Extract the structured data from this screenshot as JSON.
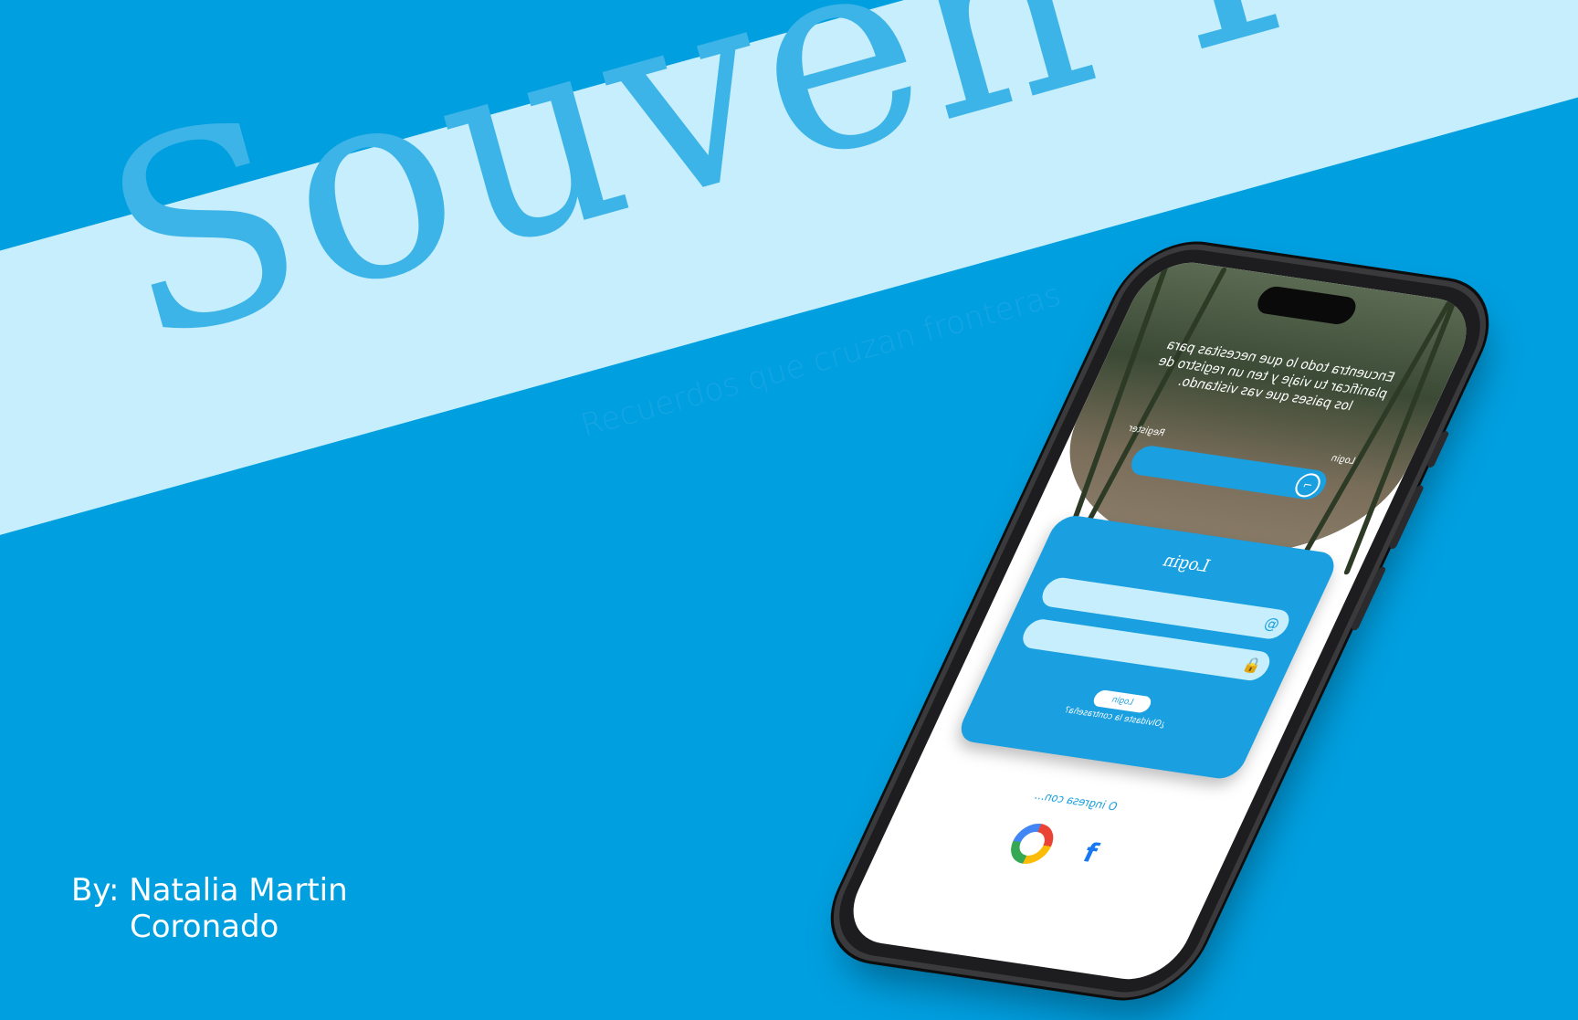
{
  "brand": {
    "title": "Souven Port",
    "tagline": "Recuerdos que cruzan fronteras"
  },
  "author": {
    "line1": "By: Natalia Martin",
    "line2": "Coronado"
  },
  "phone": {
    "hero_text": "Encuentra todo lo que necesitas para planificar tu viaje y ten un registro de los paises que vas visitando.",
    "tab_login": "Login",
    "tab_register": "Register",
    "card_title": "Login",
    "login_button": "Login",
    "forgot_password": "¿Olvidaste la contraseña?",
    "alt_login": "O ingresa con...",
    "facebook_glyph": "f"
  },
  "colors": {
    "background": "#009fe0",
    "band": "#c6eefc",
    "brand_text": "#3db4e8",
    "accent": "#1a9fe0"
  }
}
